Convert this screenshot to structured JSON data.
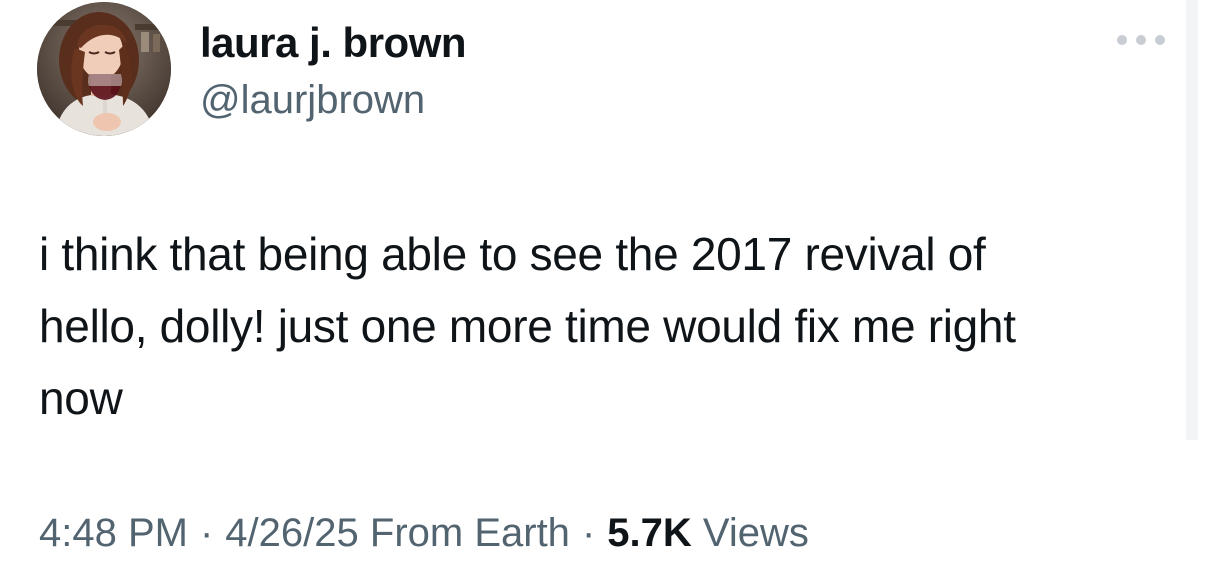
{
  "author": {
    "display_name": "laura j. brown",
    "handle": "@laurjbrown"
  },
  "more_menu": {
    "icon": "more-horizontal-icon"
  },
  "tweet": {
    "text": "i think that being able to see the 2017 revival of\nhello, dolly! just one more time would fix me right\nnow"
  },
  "meta": {
    "time": "4:48 PM",
    "separator": "·",
    "date": "4/26/25",
    "source": "From Earth",
    "views_count": "5.7K",
    "views_label": "Views"
  },
  "colors": {
    "text_primary": "#0f1419",
    "text_secondary": "#536471",
    "more_dots": "#c7cdd2"
  }
}
